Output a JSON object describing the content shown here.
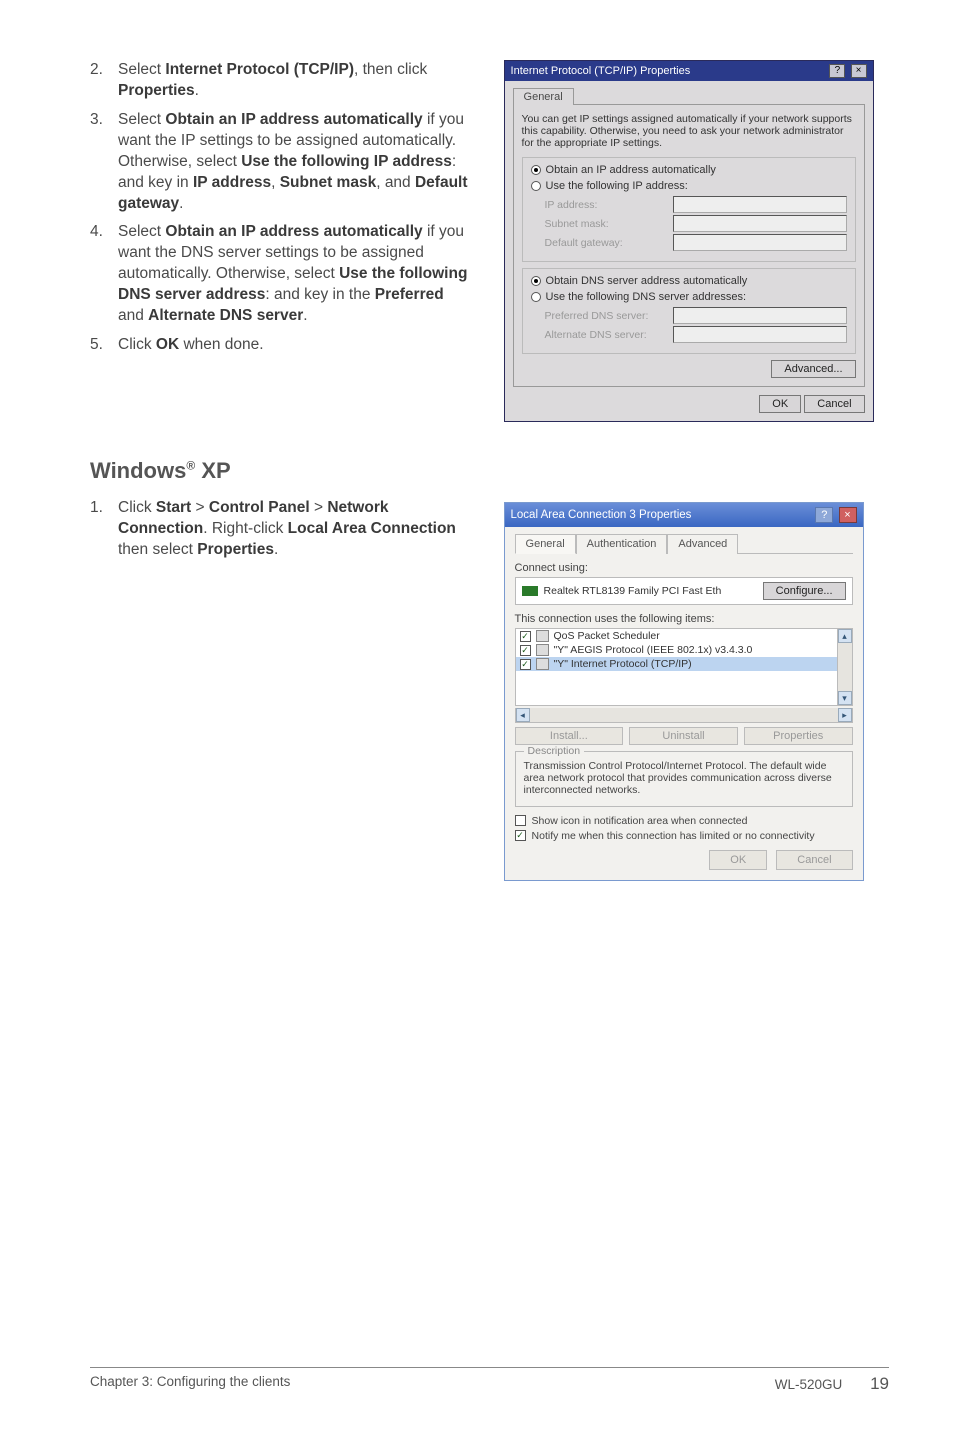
{
  "instructions": {
    "item2": {
      "num": "2.",
      "pre": "Select ",
      "b1": "Internet Protocol (TCP/IP)",
      "mid": ", then click ",
      "b2": "Properties",
      "post": "."
    },
    "item3": {
      "num": "3.",
      "pre": "Select ",
      "b1": "Obtain an IP address automatically",
      "mid1": " if you want the IP settings to be assigned automatically. Otherwise, select ",
      "b2": "Use the following IP address",
      "mid2": ": and key in ",
      "b3": "IP address",
      "mid3": ", ",
      "b4": "Subnet mask",
      "mid4": ", and ",
      "b5": "Default gateway",
      "post": "."
    },
    "item4": {
      "num": "4.",
      "pre": "Select ",
      "b1": "Obtain an IP address automatically",
      "mid1": " if you want the DNS server settings to be assigned automatically. Otherwise, select ",
      "b2": "Use the following DNS server address",
      "mid2": ": and key in the ",
      "b3": "Preferred",
      "mid3": " and ",
      "b4": "Alternate DNS server",
      "post": "."
    },
    "item5": {
      "num": "5.",
      "pre": "Click ",
      "b1": "OK",
      "post": " when done."
    }
  },
  "section_heading_pre": "Windows",
  "section_heading_sup": "®",
  "section_heading_post": " XP",
  "xp_step1": {
    "num": "1.",
    "pre": " Click ",
    "b1": "Start",
    "mid1": " > ",
    "b2": "Control Panel",
    "mid2": " > ",
    "b3": "Network Connection",
    "mid3": ". Right-click ",
    "b4": "Local Area Connection",
    "mid4": " then select ",
    "b5": "Properties",
    "post": "."
  },
  "dialog1": {
    "title": "Internet Protocol (TCP/IP) Properties",
    "help": "?",
    "close": "×",
    "tab_general": "General",
    "desc": "You can get IP settings assigned automatically if your network supports this capability. Otherwise, you need to ask your network administrator for the appropriate IP settings.",
    "radio_auto_ip": "Obtain an IP address automatically",
    "radio_use_ip": "Use the following IP address:",
    "lbl_ip": "IP address:",
    "lbl_subnet": "Subnet mask:",
    "lbl_gateway": "Default gateway:",
    "radio_auto_dns": "Obtain DNS server address automatically",
    "radio_use_dns": "Use the following DNS server addresses:",
    "lbl_pref_dns": "Preferred DNS server:",
    "lbl_alt_dns": "Alternate DNS server:",
    "btn_advanced": "Advanced...",
    "btn_ok": "OK",
    "btn_cancel": "Cancel"
  },
  "dialog2": {
    "title": "Local Area Connection 3 Properties",
    "help": "?",
    "close": "×",
    "tab_general": "General",
    "tab_auth": "Authentication",
    "tab_adv": "Advanced",
    "connect_using": "Connect using:",
    "device": "Realtek RTL8139 Family PCI Fast Eth",
    "btn_configure": "Configure...",
    "uses_label": "This connection uses the following items:",
    "items": [
      "QoS Packet Scheduler",
      "\"Y\" AEGIS Protocol (IEEE 802.1x) v3.4.3.0",
      "\"Y\" Internet Protocol (TCP/IP)"
    ],
    "btn_install": "Install...",
    "btn_uninstall": "Uninstall",
    "btn_properties": "Properties",
    "desc_legend": "Description",
    "desc": "Transmission Control Protocol/Internet Protocol. The default wide area network protocol that provides communication across diverse interconnected networks.",
    "chk_show_icon": "Show icon in notification area when connected",
    "chk_notify": "Notify me when this connection has limited or no connectivity",
    "btn_ok": "OK",
    "btn_cancel": "Cancel"
  },
  "footer": {
    "left": "Chapter 3: Configuring the clients",
    "model": "WL-520GU",
    "page": "19"
  }
}
